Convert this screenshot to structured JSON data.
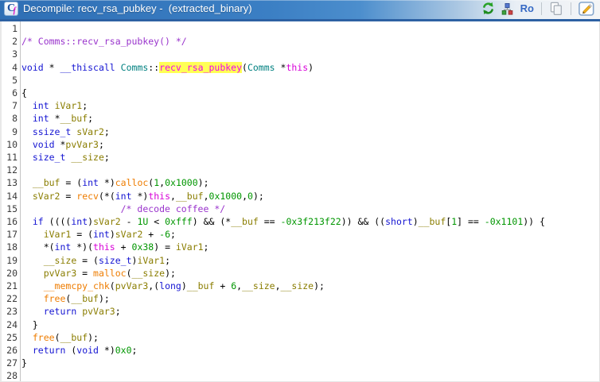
{
  "titlebar": {
    "icon_letter": "C",
    "icon_sub": "f",
    "title": "Decompile: recv_rsa_pubkey -  (extracted_binary)",
    "toolbar": {
      "refresh_icon": "refresh-arrows",
      "graph_icon": "data-type-graph",
      "ro_label": "Ro",
      "copy_icon": "copy-pages",
      "edit_icon": "edit-pencil"
    }
  },
  "colors": {
    "titlebar_blue": "#3b7fc4",
    "titlebar_border": "#2d61a3",
    "highlight_bg": "#ffff55",
    "gutter_separator": "#c4c4c4"
  },
  "code": {
    "line_numbers": [
      1,
      2,
      3,
      4,
      5,
      6,
      7,
      8,
      9,
      10,
      11,
      12,
      13,
      14,
      15,
      16,
      17,
      18,
      19,
      20,
      21,
      22,
      23,
      24,
      25,
      26,
      27,
      28
    ],
    "token_colors": {
      "kw": "#1414d2",
      "cls": "#008080",
      "fn": "#ee7c00",
      "var": "#8a7d00",
      "num": "#009600",
      "com": "#9933cc",
      "ths": "#d800d8",
      "hl": "#f000f0",
      "op": "#000000"
    },
    "highlight_bg": "#ffff55",
    "lines": [
      [],
      [
        [
          "com",
          "/* Comms::recv_rsa_pubkey() */"
        ]
      ],
      [],
      [
        [
          "kw",
          "void"
        ],
        [
          "op",
          " * "
        ],
        [
          "kw",
          "__thiscall"
        ],
        [
          "op",
          " "
        ],
        [
          "cls",
          "Comms"
        ],
        [
          "op",
          "::"
        ],
        [
          "hl",
          "recv_rsa_pubkey"
        ],
        [
          "op",
          "("
        ],
        [
          "cls",
          "Comms"
        ],
        [
          "op",
          " *"
        ],
        [
          "ths",
          "this"
        ],
        [
          "op",
          ")"
        ]
      ],
      [],
      [
        [
          "op",
          "{"
        ]
      ],
      [
        [
          "op",
          "  "
        ],
        [
          "kw",
          "int"
        ],
        [
          "op",
          " "
        ],
        [
          "var",
          "iVar1"
        ],
        [
          "op",
          ";"
        ]
      ],
      [
        [
          "op",
          "  "
        ],
        [
          "kw",
          "int"
        ],
        [
          "op",
          " *"
        ],
        [
          "var",
          "__buf"
        ],
        [
          "op",
          ";"
        ]
      ],
      [
        [
          "op",
          "  "
        ],
        [
          "kw",
          "ssize_t"
        ],
        [
          "op",
          " "
        ],
        [
          "var",
          "sVar2"
        ],
        [
          "op",
          ";"
        ]
      ],
      [
        [
          "op",
          "  "
        ],
        [
          "kw",
          "void"
        ],
        [
          "op",
          " *"
        ],
        [
          "var",
          "pvVar3"
        ],
        [
          "op",
          ";"
        ]
      ],
      [
        [
          "op",
          "  "
        ],
        [
          "kw",
          "size_t"
        ],
        [
          "op",
          " "
        ],
        [
          "var",
          "__size"
        ],
        [
          "op",
          ";"
        ]
      ],
      [],
      [
        [
          "op",
          "  "
        ],
        [
          "var",
          "__buf"
        ],
        [
          "op",
          " = ("
        ],
        [
          "kw",
          "int"
        ],
        [
          "op",
          " *)"
        ],
        [
          "fn",
          "calloc"
        ],
        [
          "op",
          "("
        ],
        [
          "num",
          "1"
        ],
        [
          "op",
          ","
        ],
        [
          "num",
          "0x1000"
        ],
        [
          "op",
          ");"
        ]
      ],
      [
        [
          "op",
          "  "
        ],
        [
          "var",
          "sVar2"
        ],
        [
          "op",
          " = "
        ],
        [
          "fn",
          "recv"
        ],
        [
          "op",
          "(*("
        ],
        [
          "kw",
          "int"
        ],
        [
          "op",
          " *)"
        ],
        [
          "ths",
          "this"
        ],
        [
          "op",
          ","
        ],
        [
          "var",
          "__buf"
        ],
        [
          "op",
          ","
        ],
        [
          "num",
          "0x1000"
        ],
        [
          "op",
          ","
        ],
        [
          "num",
          "0"
        ],
        [
          "op",
          ");"
        ]
      ],
      [
        [
          "op",
          "                  "
        ],
        [
          "com",
          "/* decode coffee */"
        ]
      ],
      [
        [
          "op",
          "  "
        ],
        [
          "kw",
          "if"
        ],
        [
          "op",
          " (((("
        ],
        [
          "kw",
          "int"
        ],
        [
          "op",
          ")"
        ],
        [
          "var",
          "sVar2"
        ],
        [
          "op",
          " - "
        ],
        [
          "num",
          "1U"
        ],
        [
          "op",
          " < "
        ],
        [
          "num",
          "0xfff"
        ],
        [
          "op",
          ") && (*"
        ],
        [
          "var",
          "__buf"
        ],
        [
          "op",
          " == "
        ],
        [
          "num",
          "-0x3f213f22"
        ],
        [
          "op",
          ")) && (("
        ],
        [
          "kw",
          "short"
        ],
        [
          "op",
          ")"
        ],
        [
          "var",
          "__buf"
        ],
        [
          "op",
          "["
        ],
        [
          "num",
          "1"
        ],
        [
          "op",
          "] == "
        ],
        [
          "num",
          "-0x1101"
        ],
        [
          "op",
          ")) {"
        ]
      ],
      [
        [
          "op",
          "    "
        ],
        [
          "var",
          "iVar1"
        ],
        [
          "op",
          " = ("
        ],
        [
          "kw",
          "int"
        ],
        [
          "op",
          ")"
        ],
        [
          "var",
          "sVar2"
        ],
        [
          "op",
          " + "
        ],
        [
          "num",
          "-6"
        ],
        [
          "op",
          ";"
        ]
      ],
      [
        [
          "op",
          "    *("
        ],
        [
          "kw",
          "int"
        ],
        [
          "op",
          " *)("
        ],
        [
          "ths",
          "this"
        ],
        [
          "op",
          " + "
        ],
        [
          "num",
          "0x38"
        ],
        [
          "op",
          ") = "
        ],
        [
          "var",
          "iVar1"
        ],
        [
          "op",
          ";"
        ]
      ],
      [
        [
          "op",
          "    "
        ],
        [
          "var",
          "__size"
        ],
        [
          "op",
          " = ("
        ],
        [
          "kw",
          "size_t"
        ],
        [
          "op",
          ")"
        ],
        [
          "var",
          "iVar1"
        ],
        [
          "op",
          ";"
        ]
      ],
      [
        [
          "op",
          "    "
        ],
        [
          "var",
          "pvVar3"
        ],
        [
          "op",
          " = "
        ],
        [
          "fn",
          "malloc"
        ],
        [
          "op",
          "("
        ],
        [
          "var",
          "__size"
        ],
        [
          "op",
          ");"
        ]
      ],
      [
        [
          "op",
          "    "
        ],
        [
          "fn",
          "__memcpy_chk"
        ],
        [
          "op",
          "("
        ],
        [
          "var",
          "pvVar3"
        ],
        [
          "op",
          ",("
        ],
        [
          "kw",
          "long"
        ],
        [
          "op",
          ")"
        ],
        [
          "var",
          "__buf"
        ],
        [
          "op",
          " + "
        ],
        [
          "num",
          "6"
        ],
        [
          "op",
          ","
        ],
        [
          "var",
          "__size"
        ],
        [
          "op",
          ","
        ],
        [
          "var",
          "__size"
        ],
        [
          "op",
          ");"
        ]
      ],
      [
        [
          "op",
          "    "
        ],
        [
          "fn",
          "free"
        ],
        [
          "op",
          "("
        ],
        [
          "var",
          "__buf"
        ],
        [
          "op",
          ");"
        ]
      ],
      [
        [
          "op",
          "    "
        ],
        [
          "kw",
          "return"
        ],
        [
          "op",
          " "
        ],
        [
          "var",
          "pvVar3"
        ],
        [
          "op",
          ";"
        ]
      ],
      [
        [
          "op",
          "  }"
        ]
      ],
      [
        [
          "op",
          "  "
        ],
        [
          "fn",
          "free"
        ],
        [
          "op",
          "("
        ],
        [
          "var",
          "__buf"
        ],
        [
          "op",
          ");"
        ]
      ],
      [
        [
          "op",
          "  "
        ],
        [
          "kw",
          "return"
        ],
        [
          "op",
          " ("
        ],
        [
          "kw",
          "void"
        ],
        [
          "op",
          " *)"
        ],
        [
          "num",
          "0x0"
        ],
        [
          "op",
          ";"
        ]
      ],
      [
        [
          "op",
          "}"
        ]
      ],
      []
    ]
  }
}
